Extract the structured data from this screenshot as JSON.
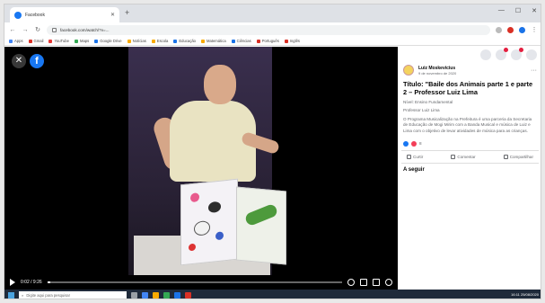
{
  "browser": {
    "tab_title": "Facebook",
    "url": "facebook.com/watch/?v=...",
    "bookmarks": [
      "Apps",
      "Gmail",
      "YouTube",
      "Maps",
      "Google Drive",
      "Notícias",
      "Escola",
      "Educação",
      "Matemática",
      "Ciências",
      "Português",
      "Inglês"
    ]
  },
  "video": {
    "time_label": "0:02 / 9:26",
    "progress_fraction": 0.01
  },
  "post": {
    "author": "Luiz Moskevicius",
    "date": "9 de novembro de 2020",
    "title": "Título: \"Baile dos Animais parte 1 e parte 2 – Professor Luiz Lima",
    "body": [
      "Nível: Ensino Fundamental",
      "Professor Luiz Lima",
      "O Programa Musicalização na Prefeitura é uma parceria da Secretaria de Educação de Mogi Mirim com a Banda Musical e música de Luiz e Lima com o objetivo de levar atividades de música para as crianças."
    ],
    "reaction_count": "8",
    "actions": [
      "Curtir",
      "Comentar",
      "Compartilhar"
    ],
    "next_label": "A seguir"
  },
  "taskbar": {
    "search_placeholder": "Digite aqui para pesquisar",
    "clock": "16:11 25/08/2020"
  }
}
